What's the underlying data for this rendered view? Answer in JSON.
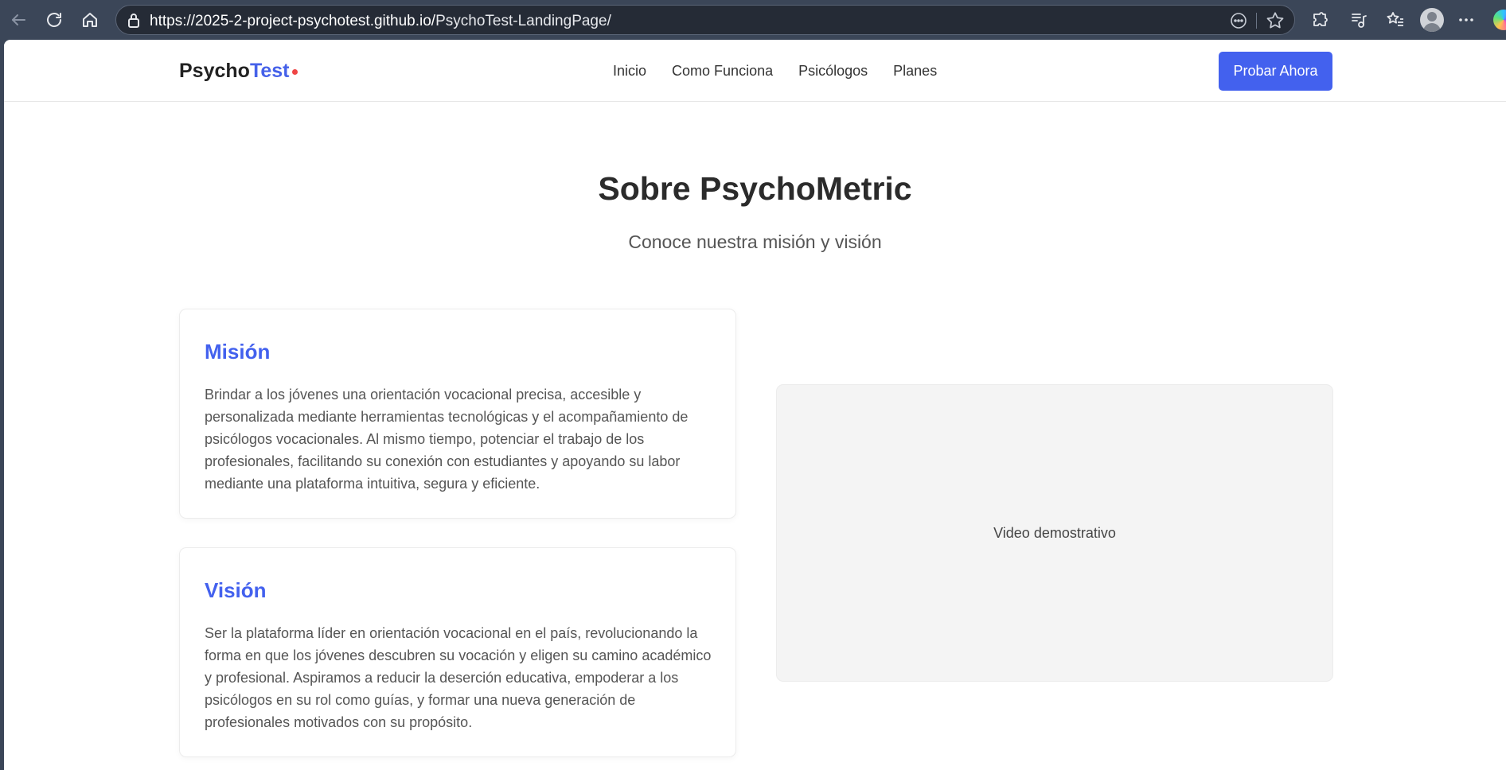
{
  "browser": {
    "url_host": "https://2025-2-project-psychotest.github.io/",
    "url_path": "PsychoTest-LandingPage/"
  },
  "header": {
    "logo_part1": "Psycho",
    "logo_part2": "Test",
    "nav": [
      "Inicio",
      "Como Funciona",
      "Psicólogos",
      "Planes"
    ],
    "cta_label": "Probar Ahora"
  },
  "section": {
    "title": "Sobre PsychoMetric",
    "subtitle": "Conoce nuestra misión y visión"
  },
  "cards": [
    {
      "title": "Misión",
      "text": "Brindar a los jóvenes una orientación vocacional precisa, accesible y personalizada mediante herramientas tecnológicas y el acompañamiento de psicólogos vocacionales. Al mismo tiempo, potenciar el trabajo de los profesionales, facilitando su conexión con estudiantes y apoyando su labor mediante una plataforma intuitiva, segura y eficiente."
    },
    {
      "title": "Visión",
      "text": "Ser la plataforma líder en orientación vocacional en el país, revolucionando la forma en que los jóvenes descubren su vocación y eligen su camino académico y profesional. Aspiramos a reducir la deserción educativa, empoderar a los psicólogos en su rol como guías, y formar una nueva generación de profesionales motivados con su propósito."
    }
  ],
  "video": {
    "label": "Video demostrativo"
  },
  "colors": {
    "accent": "#4361ee",
    "logo_dot": "#ef4444",
    "chrome_bg": "#3b4658"
  }
}
